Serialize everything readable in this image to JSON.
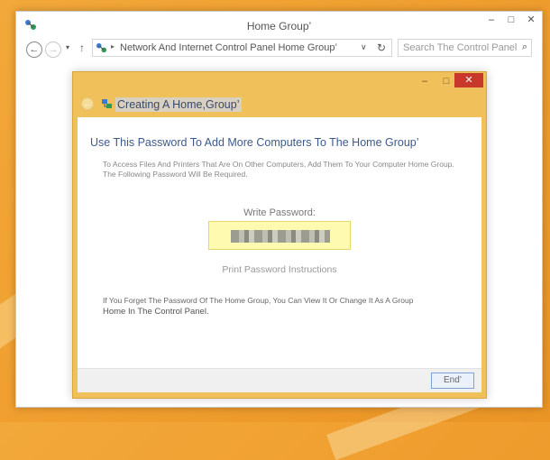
{
  "window": {
    "title": "Home Group’",
    "controls": {
      "minimize": "–",
      "maximize": "□",
      "close": "✕"
    }
  },
  "navbar": {
    "back_icon": "←",
    "forward_icon": "→",
    "dropdown_icon": "▾",
    "up_icon": "↑",
    "address_separator": "▸",
    "address_text": "Network And Internet Control Panel Home Group’",
    "address_dropdown_icon": "∨",
    "refresh_icon": "↻",
    "search_placeholder": "Search The Control Panel",
    "search_icon": "⌕"
  },
  "dialog": {
    "controls": {
      "minimize": "–",
      "maximize": "□",
      "close": "✕"
    },
    "back_icon": "←",
    "title": "Creating A Home,Group’",
    "heading": "Use This Password To Add More Computers To The Home Group’",
    "description": "To Access Files And Printers That Are On Other Computers, Add Them To Your Computer Home Group. The Following Password Will Be Required.",
    "password_label": "Write Password:",
    "print_link": "Print Password Instructions",
    "forget_line1": "If You Forget The Password Of The Home Group, You Can View It Or Change It As A Group",
    "forget_line2": "Home In The Control Panel.",
    "end_button": "End’"
  },
  "colors": {
    "desktop": "#f0a030",
    "dialog_frame": "#f0c15a",
    "close_button": "#c9392b",
    "password_box": "#fefab0",
    "heading_text": "#3d5a8a"
  }
}
